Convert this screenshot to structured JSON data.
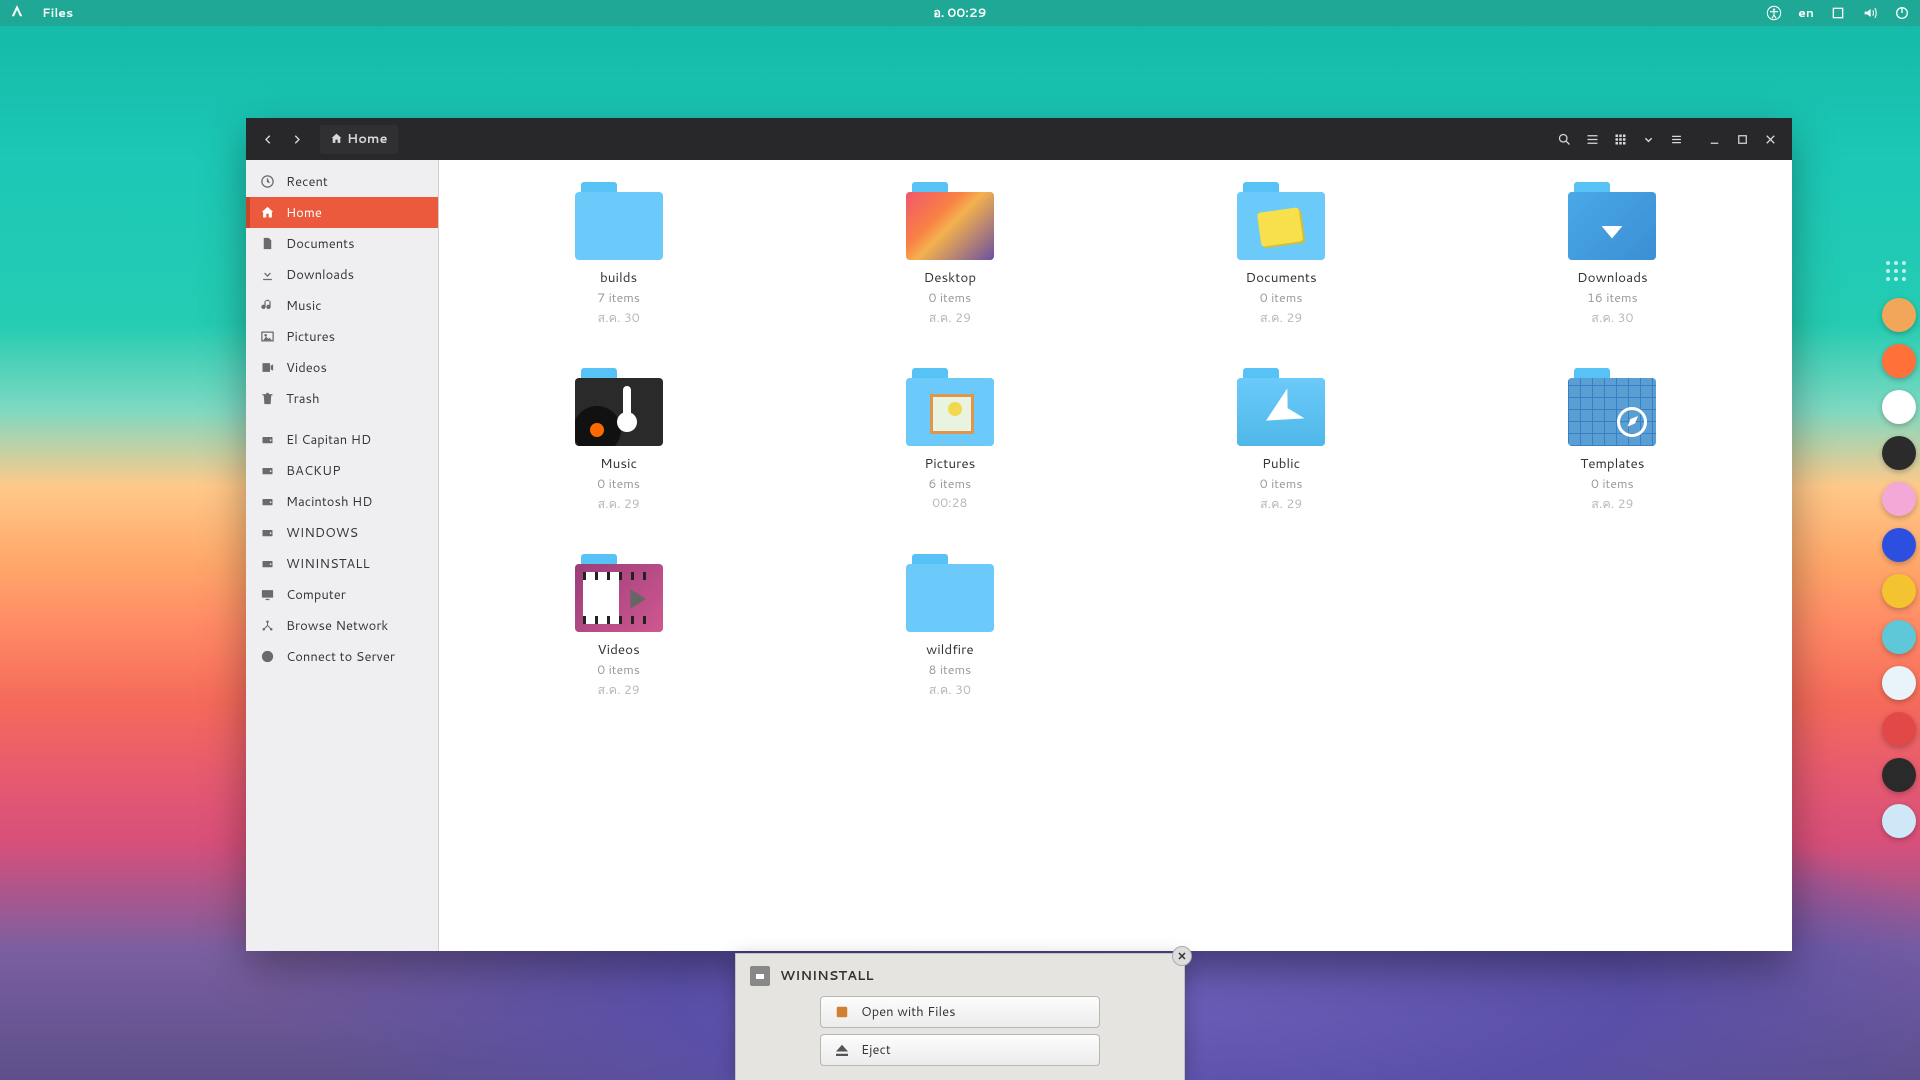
{
  "panel": {
    "app_name": "Files",
    "clock_prefix": "อ.",
    "clock_time": "00:29",
    "lang": "en"
  },
  "window": {
    "location_label": "Home"
  },
  "sidebar": {
    "items": [
      {
        "label": "Recent",
        "icon": "clock"
      },
      {
        "label": "Home",
        "icon": "home",
        "active": true
      },
      {
        "label": "Documents",
        "icon": "doc"
      },
      {
        "label": "Downloads",
        "icon": "down"
      },
      {
        "label": "Music",
        "icon": "music"
      },
      {
        "label": "Pictures",
        "icon": "pic"
      },
      {
        "label": "Videos",
        "icon": "video"
      },
      {
        "label": "Trash",
        "icon": "trash"
      }
    ],
    "devices": [
      {
        "label": "El Capitan HD"
      },
      {
        "label": "BACKUP"
      },
      {
        "label": "Macintosh HD"
      },
      {
        "label": "WINDOWS"
      },
      {
        "label": "WININSTALL",
        "ejectable": true
      }
    ],
    "other": [
      {
        "label": "Computer",
        "icon": "computer"
      },
      {
        "label": "Browse Network",
        "icon": "network"
      },
      {
        "label": "Connect to Server",
        "icon": "globe"
      }
    ]
  },
  "folders": [
    {
      "name": "builds",
      "items": "7 items",
      "date": "ส.ค. 30",
      "variant": "plain"
    },
    {
      "name": "Desktop",
      "items": "0 items",
      "date": "ส.ค. 29",
      "variant": "desktop"
    },
    {
      "name": "Documents",
      "items": "0 items",
      "date": "ส.ค. 29",
      "variant": "docs"
    },
    {
      "name": "Downloads",
      "items": "16 items",
      "date": "ส.ค. 30",
      "variant": "down"
    },
    {
      "name": "Music",
      "items": "0 items",
      "date": "ส.ค. 29",
      "variant": "music"
    },
    {
      "name": "Pictures",
      "items": "6 items",
      "date": "00:28",
      "variant": "pics"
    },
    {
      "name": "Public",
      "items": "0 items",
      "date": "ส.ค. 29",
      "variant": "public"
    },
    {
      "name": "Templates",
      "items": "0 items",
      "date": "ส.ค. 29",
      "variant": "tmpl"
    },
    {
      "name": "Videos",
      "items": "0 items",
      "date": "ส.ค. 29",
      "variant": "video"
    },
    {
      "name": "wildfire",
      "items": "8 items",
      "date": "ส.ค. 30",
      "variant": "plain"
    }
  ],
  "notification": {
    "title": "WININSTALL",
    "open_label": "Open with Files",
    "eject_label": "Eject"
  },
  "dock": [
    {
      "name": "files",
      "bg": "#f2a65a"
    },
    {
      "name": "firefox",
      "bg": "#ff7139"
    },
    {
      "name": "chrome",
      "bg": "#fff"
    },
    {
      "name": "terminal",
      "bg": "#2b2b2b"
    },
    {
      "name": "app-pink",
      "bg": "#f4a8d8"
    },
    {
      "name": "app-blue",
      "bg": "#2d4fe0"
    },
    {
      "name": "app-yellow",
      "bg": "#f4c430"
    },
    {
      "name": "app-cyan",
      "bg": "#5ec8d8"
    },
    {
      "name": "safari",
      "bg": "#e8f4fa"
    },
    {
      "name": "app-red",
      "bg": "#e24848"
    },
    {
      "name": "app-dark",
      "bg": "#2a2a2a"
    },
    {
      "name": "chromium",
      "bg": "#cfe8f8"
    }
  ]
}
